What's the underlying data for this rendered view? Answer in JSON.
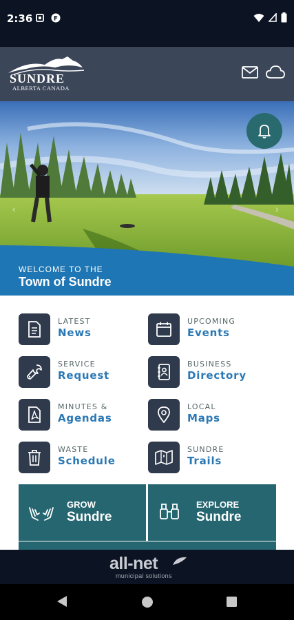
{
  "status_bar": {
    "time": "2:36"
  },
  "header": {
    "logo_title": "SUNDRE",
    "logo_subtitle": "ALBERTA CANADA",
    "icons": [
      "mail-icon",
      "cloud-icon"
    ]
  },
  "hero": {
    "welcome_line1": "WELCOME TO THE",
    "welcome_line2": "Town of Sundre"
  },
  "tiles": [
    {
      "small": "LATEST",
      "big": "News",
      "icon": "document-icon"
    },
    {
      "small": "UPCOMING",
      "big": "Events",
      "icon": "calendar-icon"
    },
    {
      "small": "SERVICE",
      "big": "Request",
      "icon": "wrench-icon"
    },
    {
      "small": "BUSINESS",
      "big": "Directory",
      "icon": "contact-book-icon"
    },
    {
      "small": "MINUTES &",
      "big": "Agendas",
      "icon": "pdf-icon"
    },
    {
      "small": "LOCAL",
      "big": "Maps",
      "icon": "map-pin-icon"
    },
    {
      "small": "WASTE",
      "big": "Schedule",
      "icon": "trash-icon"
    },
    {
      "small": "SUNDRE",
      "big": "Trails",
      "icon": "trail-map-icon"
    }
  ],
  "feature_buttons": [
    {
      "small": "GROW",
      "big": "Sundre",
      "icon": "hands-icon"
    },
    {
      "small": "EXPLORE",
      "big": "Sundre",
      "icon": "binoculars-icon"
    }
  ],
  "footer": {
    "brand": "all-net",
    "tagline": "municipal solutions"
  },
  "colors": {
    "header": "#3b4658",
    "tile": "#2f3a4c",
    "link": "#2a78b5",
    "teal": "#266670",
    "band": "#1f76b4"
  }
}
